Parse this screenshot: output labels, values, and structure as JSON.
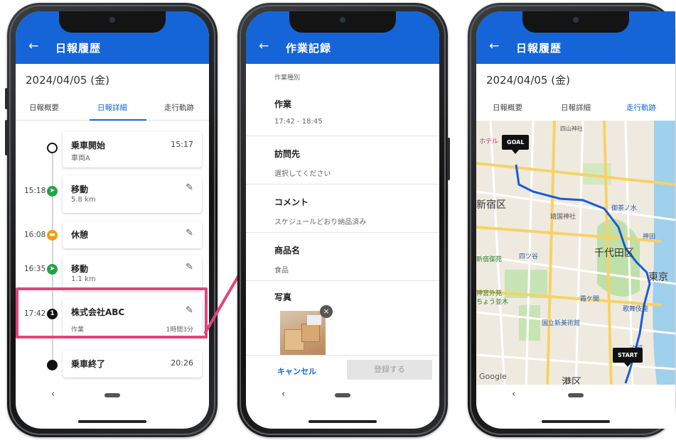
{
  "screens": {
    "daily_detail": {
      "title": "日報履歴",
      "back": "←",
      "date": "2024/04/05 (金)",
      "tabs": [
        "日報概要",
        "日報詳細",
        "走行軌跡"
      ],
      "timeline": [
        {
          "time": "",
          "title": "乗車開始",
          "sub": "車両A",
          "right": "15:17",
          "dot": "start"
        },
        {
          "time": "15:18",
          "title": "移動",
          "sub": "5.8 km",
          "right": "✎",
          "dot": "move"
        },
        {
          "time": "16:08",
          "title": "休憩",
          "sub": "",
          "right": "✎",
          "dot": "break"
        },
        {
          "time": "16:35",
          "title": "移動",
          "sub": "1.1 km",
          "right": "✎",
          "dot": "move"
        },
        {
          "time": "17:42",
          "title": "株式会社ABC",
          "sub": "作業",
          "sub2": "1時間3分",
          "right": "✎",
          "dot": "1"
        },
        {
          "time": "",
          "title": "乗車終了",
          "sub": "",
          "right": "20:26",
          "dot": "end"
        }
      ]
    },
    "work_record": {
      "title": "作業記録",
      "back": "←",
      "section_label": "作業種別",
      "fields": [
        {
          "label": "作業",
          "value": "17:42 - 18:45"
        },
        {
          "label": "訪問先",
          "value": "選択してください"
        },
        {
          "label": "コメント",
          "value": "スケジュールどおり納品済み"
        },
        {
          "label": "商品名",
          "value": "食品"
        },
        {
          "label": "写真",
          "value": ""
        }
      ],
      "photo_remove": "×",
      "cancel_label": "キャンセル",
      "submit_label": "登録する"
    },
    "route_map": {
      "title": "日報履歴",
      "back": "←",
      "date": "2024/04/05 (金)",
      "tabs": [
        "日報概要",
        "日報詳細",
        "走行軌跡"
      ],
      "goal_label": "GOAL",
      "start_label": "START",
      "map_labels": {
        "shinjuku": "新宿区",
        "chiyoda": "千代田区",
        "tokyo": "東京",
        "minato": "港区",
        "yasukuni": "靖国神社",
        "yotsuya": "四ツ谷",
        "ochanomizu": "御茶ノ水",
        "kanda": "神田",
        "shinjuku_gyoen": "新宿御苑",
        "meiji": "神宮外苑",
        "ichou": "ちょう並木",
        "kasumigaseki": "霞ケ関",
        "kabukiza": "歌舞伎座",
        "nact": "国立新美術館",
        "shiodome": "汐留",
        "hotel": "ホテル",
        "google": "Google",
        "kanji_top": "四山神社"
      }
    },
    "nav": {
      "chevron": "‹"
    }
  },
  "colors": {
    "primary": "#1565d8",
    "highlight": "#e0457b",
    "move": "#22a447",
    "break": "#f39c12"
  }
}
